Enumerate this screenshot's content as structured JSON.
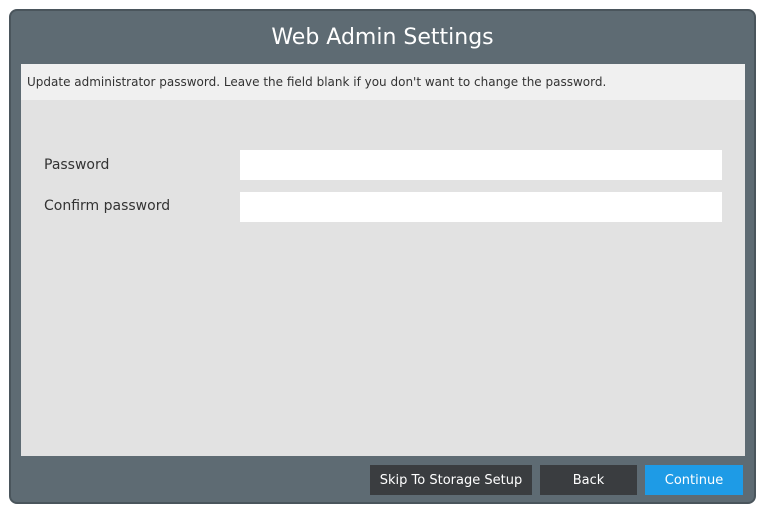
{
  "dialog": {
    "title": "Web Admin Settings",
    "description": "Update administrator password. Leave the field blank if you don't want to change the password."
  },
  "form": {
    "password_label": "Password",
    "password_value": "",
    "confirm_label": "Confirm password",
    "confirm_value": ""
  },
  "footer": {
    "skip_label": "Skip To Storage Setup",
    "back_label": "Back",
    "continue_label": "Continue"
  },
  "colors": {
    "frame": "#5e6b73",
    "content": "#e2e2e2",
    "dark_button": "#3a3d40",
    "accent": "#1e9be6"
  }
}
